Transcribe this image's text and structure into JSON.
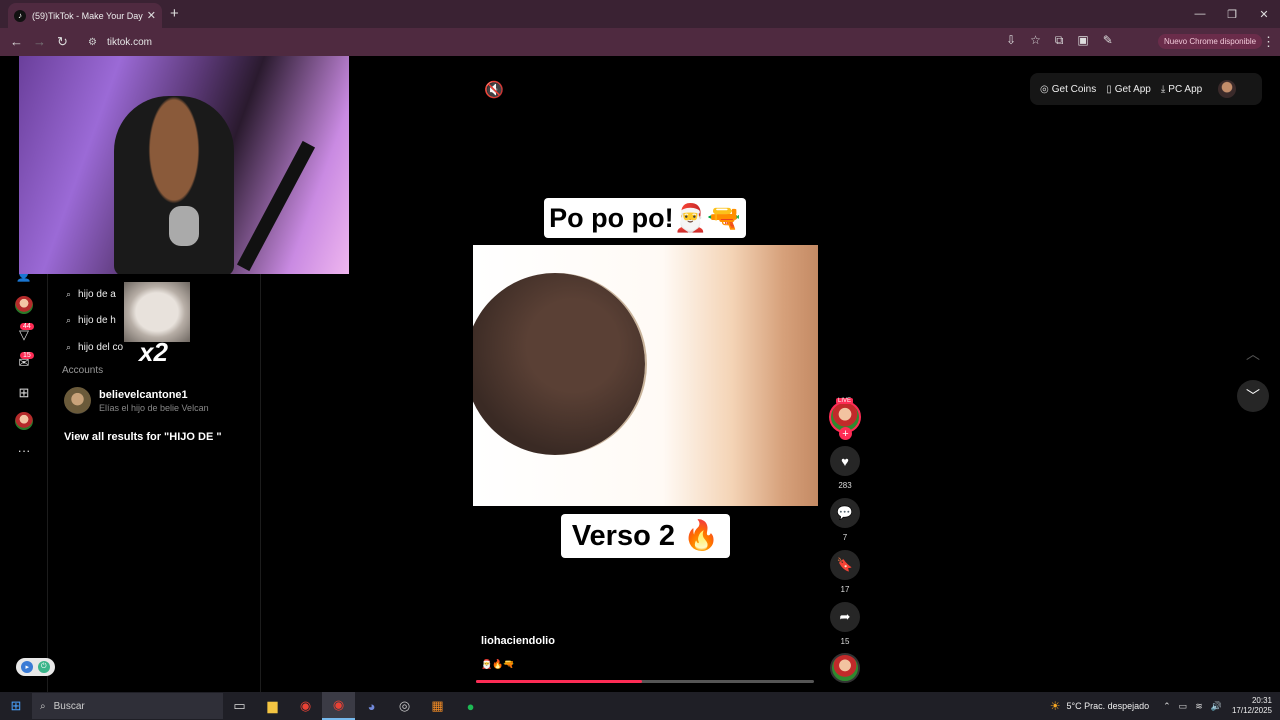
{
  "browser": {
    "tab_title": "(59)TikTok - Make Your Day",
    "tab_close": "✕",
    "new_tab": "+",
    "url": "tiktok.com",
    "update_label": "Nuevo Chrome disponible",
    "window_controls": {
      "minimize": "—",
      "restore": "❐",
      "close": "✕"
    }
  },
  "search_panel": {
    "suggestions": [
      {
        "text": "hijo de a"
      },
      {
        "text": "hijo de h"
      },
      {
        "text": "hijo del co"
      }
    ],
    "accounts_header": "Accounts",
    "account": {
      "name": "believelcantone1",
      "subtitle": "Elías el hijo de belie Velcan"
    },
    "view_all": "View all results for \"HIJO DE \""
  },
  "left_rail": {
    "badges": {
      "inbox": "44",
      "messages": "15"
    }
  },
  "overlay": {
    "x2_text": "x2"
  },
  "top_actions": {
    "get_coins": "Get Coins",
    "get_app": "Get App",
    "pc_app": "PC App"
  },
  "video": {
    "caption_top": "Po po po!🎅🔫",
    "caption_bottom": "Verso 2 🔥",
    "author": "liohaciendolio",
    "description": "🎅🔥🔫",
    "progress": 0.49,
    "live_badge": "LIVE"
  },
  "actions": {
    "likes": "283",
    "comments": "7",
    "saves": "17",
    "shares": "15"
  },
  "taskbar": {
    "search_placeholder": "Buscar",
    "weather": "5°C  Prac. despejado",
    "time": "20:31",
    "date": "17/12/2025"
  },
  "colors": {
    "accent": "#fe2c55",
    "chrome_bg": "#4f2a40",
    "tabbar_bg": "#3a2233"
  }
}
